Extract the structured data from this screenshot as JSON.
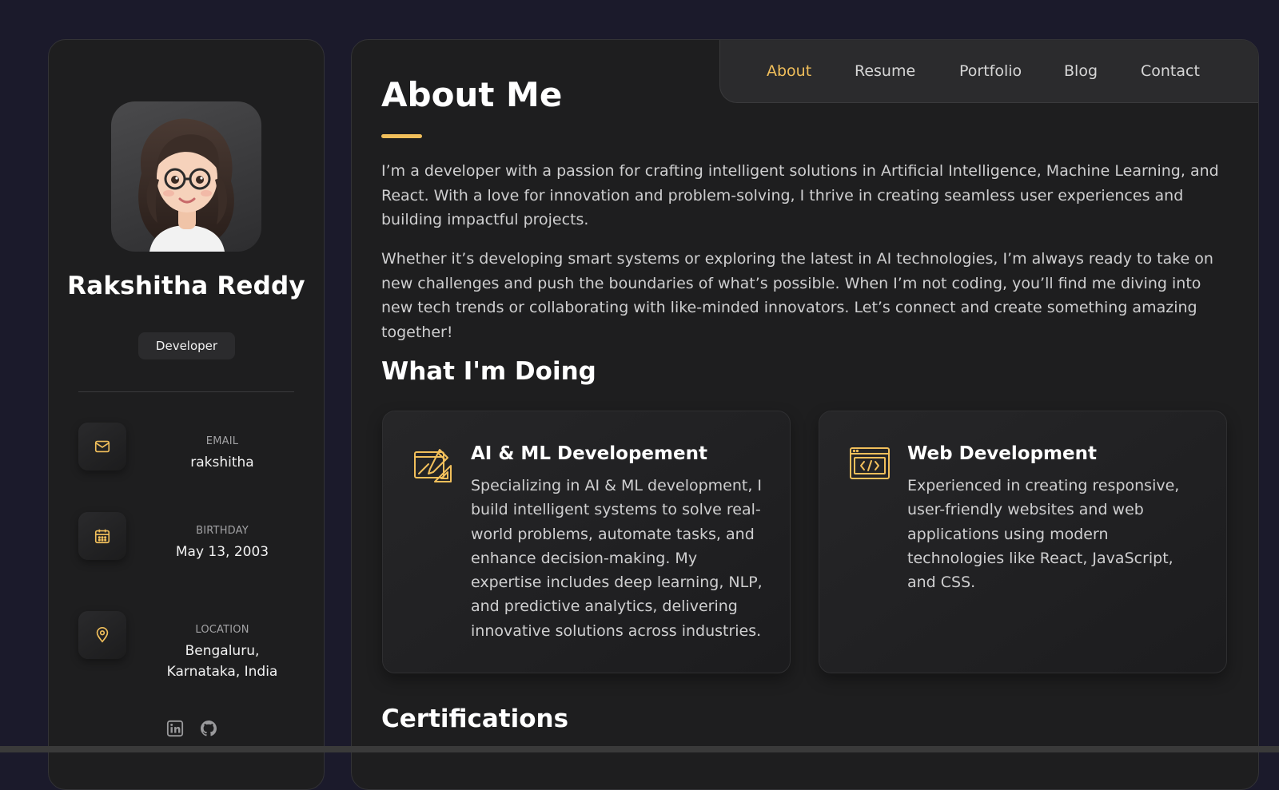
{
  "profile": {
    "name": "Rakshitha Reddy",
    "role": "Developer",
    "avatar_icon": "avatar-illustration"
  },
  "contacts": [
    {
      "label": "EMAIL",
      "value": "rakshitha",
      "icon": "mail-icon"
    },
    {
      "label": "BIRTHDAY",
      "value": "May 13, 2003",
      "icon": "calendar-icon"
    },
    {
      "label": "LOCATION",
      "value_lines": [
        "Bengaluru,",
        "Karnataka, India"
      ],
      "icon": "location-pin-icon"
    }
  ],
  "socials": [
    {
      "icon": "linkedin-icon"
    },
    {
      "icon": "github-icon"
    }
  ],
  "nav": {
    "items": [
      {
        "label": "About",
        "active": true
      },
      {
        "label": "Resume",
        "active": false
      },
      {
        "label": "Portfolio",
        "active": false
      },
      {
        "label": "Blog",
        "active": false
      },
      {
        "label": "Contact",
        "active": false
      }
    ]
  },
  "about": {
    "title": "About Me",
    "paragraphs": [
      "I’m a developer with a passion for crafting intelligent solutions in Artificial Intelligence, Machine Learning, and React. With a love for innovation and problem-solving, I thrive in creating seamless user experiences and building impactful projects.",
      "Whether it’s developing smart systems or exploring the latest in AI technologies, I’m always ready to take on new challenges and push the boundaries of what’s possible. When I’m not coding, you’ll find me diving into new tech trends or collaborating with like-minded innovators. Let’s connect and create something amazing together!"
    ]
  },
  "services": {
    "title": "What I'm Doing",
    "items": [
      {
        "title": "AI & ML Developement",
        "text": "Specializing in AI & ML development, I build intelligent systems to solve real-world problems, automate tasks, and enhance decision-making. My expertise includes deep learning, NLP, and predictive analytics, delivering innovative solutions across industries.",
        "icon": "design-tools-icon"
      },
      {
        "title": "Web Development",
        "text": "Experienced in creating responsive, user-friendly websites and web applications using modern technologies like React, JavaScript, and CSS.",
        "icon": "code-window-icon"
      }
    ]
  },
  "certifications": {
    "title": "Certifications"
  },
  "colors": {
    "accent": "#f1bf5b",
    "page_background": "#1b1a2b",
    "panel_background": "#1e1e1f"
  }
}
